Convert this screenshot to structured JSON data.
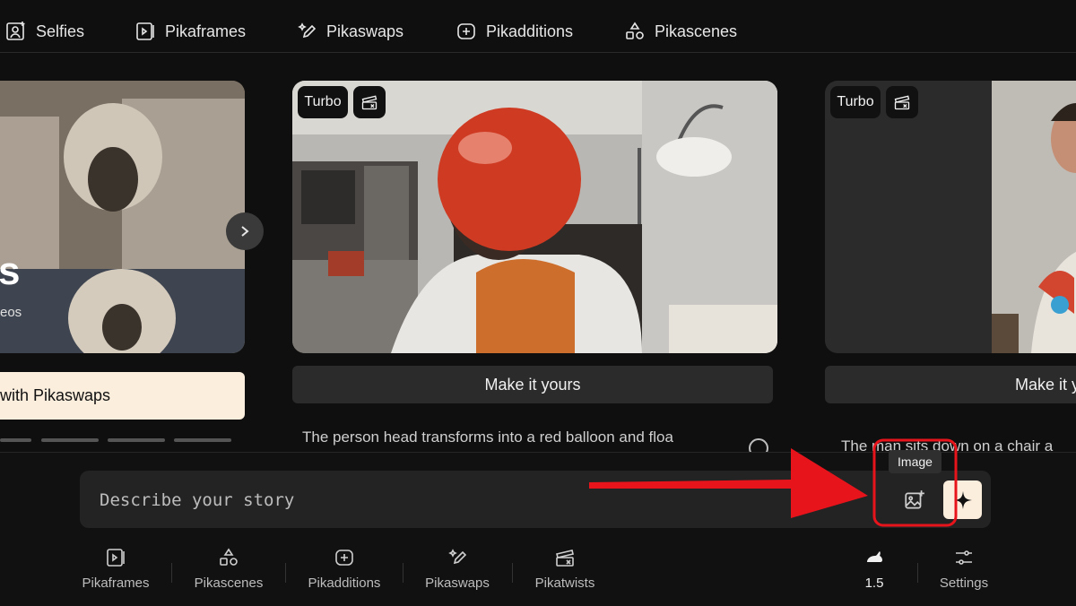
{
  "topnav": {
    "items": [
      {
        "label": "Selfies",
        "icon": "selfie-icon"
      },
      {
        "label": "Pikaframes",
        "icon": "frames-icon"
      },
      {
        "label": "Pikaswaps",
        "icon": "swap-wand-icon"
      },
      {
        "label": "Pikadditions",
        "icon": "additions-icon"
      },
      {
        "label": "Pikascenes",
        "icon": "scenes-icon"
      }
    ]
  },
  "cards": [
    {
      "title_fragment": "s",
      "sub_fragment": "eos",
      "button": "with Pikaswaps"
    },
    {
      "badge": "Turbo",
      "button": "Make it yours",
      "description": "The person head transforms into a red balloon and floa"
    },
    {
      "badge": "Turbo",
      "button": "Make it y",
      "description": "The man sits down on a chair a"
    }
  ],
  "composer": {
    "placeholder": "Describe your story",
    "tooltip": "Image"
  },
  "bottom_bar": {
    "items": [
      {
        "label": "Pikaframes",
        "icon": "frames-icon"
      },
      {
        "label": "Pikascenes",
        "icon": "scenes-icon"
      },
      {
        "label": "Pikadditions",
        "icon": "additions-icon"
      },
      {
        "label": "Pikaswaps",
        "icon": "swap-wand-icon"
      },
      {
        "label": "Pikatwists",
        "icon": "twist-icon"
      }
    ],
    "model": "1.5",
    "settings": "Settings"
  },
  "colors": {
    "annotation_red": "#e8141c",
    "accent_cream": "#fbeedd"
  }
}
